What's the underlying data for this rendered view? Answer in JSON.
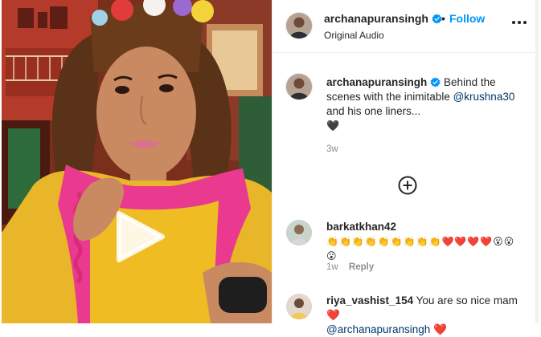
{
  "post": {
    "username": "archanapuransingh",
    "follow_label": "Follow",
    "separator": "•",
    "audio_label": "Original Audio",
    "caption_prefix": "Behind the scenes with the inimitable",
    "caption_mention": "@krushna30",
    "caption_suffix": "and his one liners...",
    "caption_emoji": "🖤",
    "timestamp": "3w"
  },
  "comments": [
    {
      "username": "barkatkhan42",
      "text": "👏👏👏👏👏👏👏👏👏❤️❤️❤️❤️😮😮😮",
      "timestamp": "1w",
      "reply_label": "Reply"
    },
    {
      "username": "riya_vashist_154",
      "text": "You are so nice mam",
      "emoji": "❤️",
      "mention": "@archanapuransingh",
      "emoji2": "❤️"
    }
  ],
  "icons": {
    "verified": "verified-badge-icon",
    "more": "more-options-icon",
    "add": "add-circle-icon",
    "play": "play-icon"
  },
  "colors": {
    "accent": "#0095f6",
    "verified": "#0095f6",
    "mention": "#00376b",
    "muted": "#8e8e8e"
  }
}
